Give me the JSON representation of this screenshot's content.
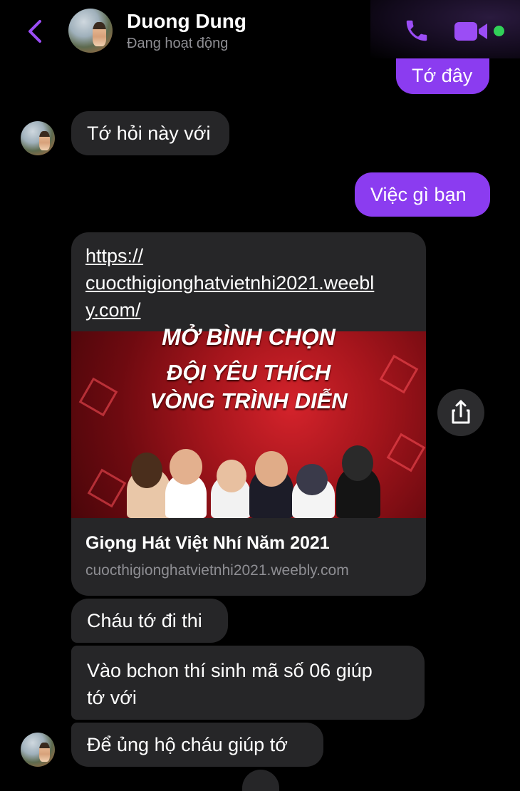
{
  "header": {
    "contact_name": "Duong Dung",
    "status": "Đang hoạt động",
    "online_color": "#31d158",
    "accent_color": "#8b3cf0"
  },
  "messages": [
    {
      "side": "sent",
      "text": "Tớ đây"
    },
    {
      "side": "received",
      "text": "Tớ hỏi này với"
    },
    {
      "side": "sent",
      "text": "Việc gì bạn"
    },
    {
      "side": "received",
      "type": "link-preview",
      "url_lines": [
        "https://",
        "cuocthigionghatvietnhi2021.weebl",
        "y.com/"
      ],
      "image_text_top": "MỞ BÌNH CHỌN",
      "image_text_line1": "ĐỘI YÊU THÍCH",
      "image_text_line2": "VÒNG TRÌNH DIỄN",
      "title": "Giọng Hát Việt Nhí Năm 2021",
      "domain": "cuocthigionghatvietnhi2021.weebly.com"
    },
    {
      "side": "received",
      "text": "Cháu tớ đi thi"
    },
    {
      "side": "received",
      "text_lines": [
        "Vào bchon thí sinh mã số 06 giúp",
        "tớ với"
      ]
    },
    {
      "side": "received",
      "text": "Để ủng hộ cháu giúp tớ"
    }
  ],
  "icons": {
    "back": "chevron-left-icon",
    "call": "phone-icon",
    "video": "video-camera-icon",
    "share": "share-icon"
  }
}
